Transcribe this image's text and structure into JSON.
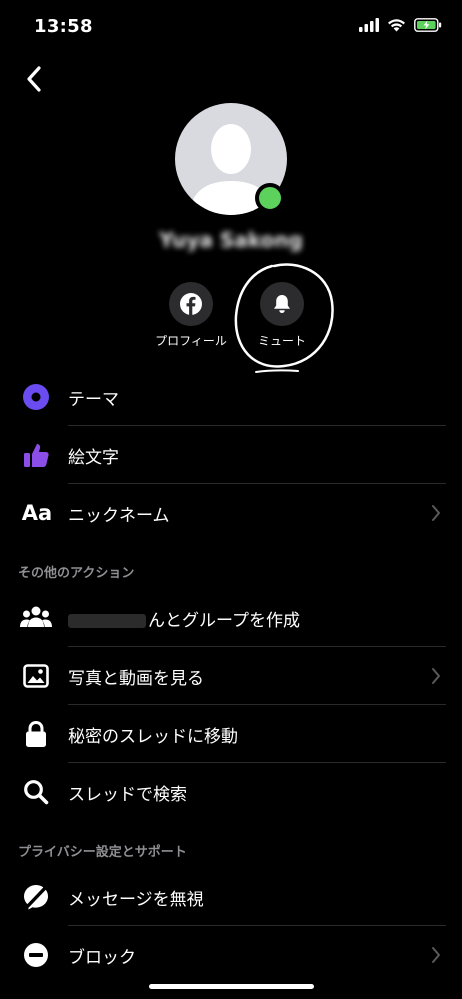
{
  "status_bar": {
    "time": "13:58"
  },
  "profile": {
    "name": "Yuya Sakong"
  },
  "actions": [
    {
      "label": "プロフィール",
      "icon": "facebook-icon"
    },
    {
      "label": "ミュート",
      "icon": "bell-icon"
    }
  ],
  "menu": {
    "theme": "テーマ",
    "emoji": "絵文字",
    "nickname": "ニックネーム",
    "nickname_icon": "Aa"
  },
  "other_actions": {
    "header": "その他のアクション",
    "create_group": "んとグループを作成",
    "photos": "写真と動画を見る",
    "secret": "秘密のスレッドに移動",
    "search": "スレッドで検索"
  },
  "privacy": {
    "header": "プライバシー設定とサポート",
    "ignore": "メッセージを無視",
    "block": "ブロック"
  },
  "colors": {
    "theme_purple": "#6a4cf0",
    "online_green": "#5cd15c",
    "emoji_purple": "#8c4ee8"
  }
}
